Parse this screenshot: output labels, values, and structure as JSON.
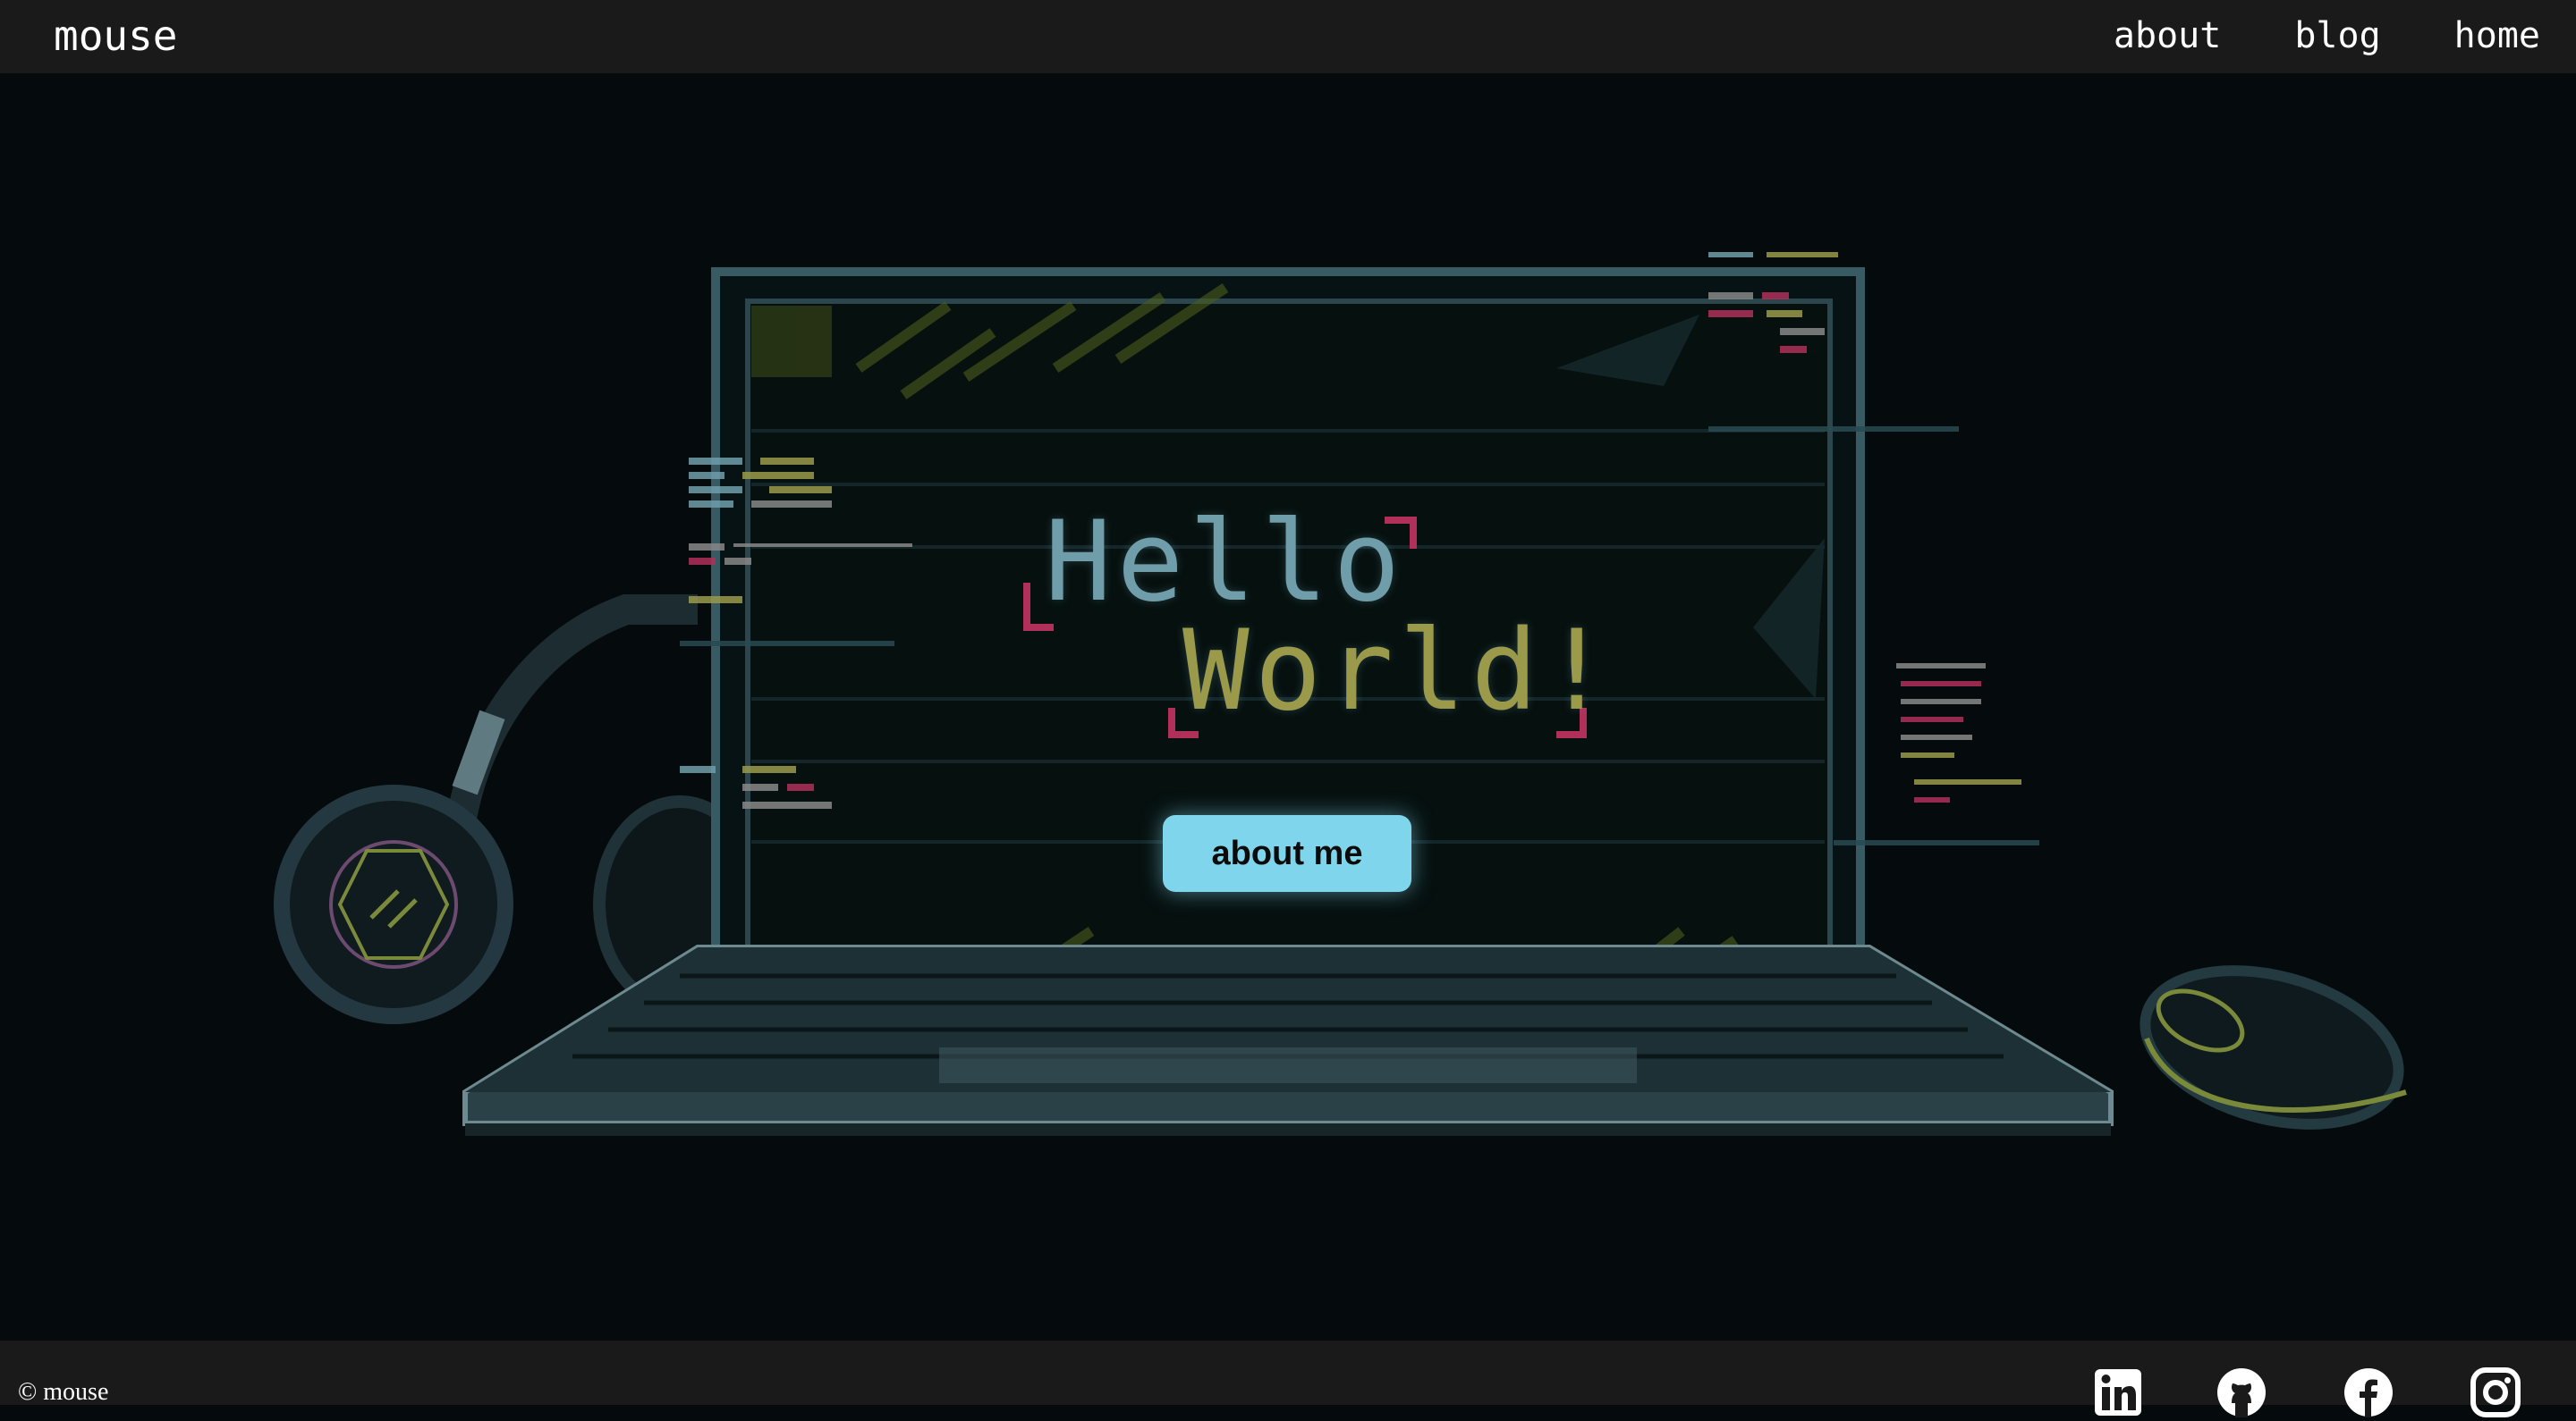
{
  "header": {
    "brand": "mouse",
    "nav": [
      {
        "label": "about"
      },
      {
        "label": "blog"
      },
      {
        "label": "home"
      }
    ]
  },
  "hero": {
    "line1": "Hello",
    "line2": "World!",
    "cta_label": "about me"
  },
  "footer": {
    "copyright": "© mouse",
    "social": [
      {
        "icon": "linkedin-icon"
      },
      {
        "icon": "github-icon"
      },
      {
        "icon": "facebook-icon"
      },
      {
        "icon": "instagram-icon"
      }
    ]
  },
  "colors": {
    "header_bg": "#1a1a1a",
    "page_bg": "#050b0d",
    "button_bg": "#7fd6ec",
    "pixel_blue": "#6f9eaa",
    "pixel_olive": "#9a9a4a",
    "pixel_magenta": "#b0305a"
  }
}
